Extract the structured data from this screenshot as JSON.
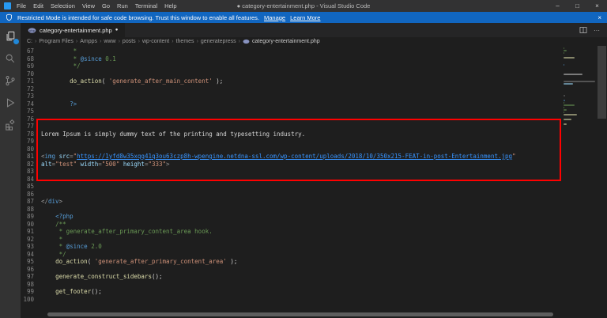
{
  "window": {
    "menus": [
      "File",
      "Edit",
      "Selection",
      "View",
      "Go",
      "Run",
      "Terminal",
      "Help"
    ],
    "title": "● category-entertainment.php - Visual Studio Code",
    "controls": {
      "minimize": "–",
      "maximize": "□",
      "close": "×"
    }
  },
  "banner": {
    "message": "Restricted Mode is intended for safe code browsing. Trust this window to enable all features.",
    "manage_link": "Manage",
    "learn_link": "Learn More",
    "close": "×"
  },
  "activity_bar": {
    "items": [
      "explorer",
      "search",
      "source-control",
      "run-debug",
      "extensions"
    ],
    "explorer_badge": true
  },
  "tabs": {
    "active": {
      "label": "category-entertainment.php",
      "modified": "●"
    },
    "actions": {
      "more": "···"
    }
  },
  "breadcrumb": {
    "separator": "›",
    "items": [
      "C:",
      "Program Files",
      "Ampps",
      "www",
      "posts",
      "wp-content",
      "themes",
      "generatepress",
      "category-entertainment.php"
    ]
  },
  "colors": {
    "banner_blue": "#1166c0",
    "badge_blue": "#2188d9",
    "annotation_red": "#ff0000",
    "php_icon_purple": "#8892bf"
  },
  "editor": {
    "lines": [
      {
        "n": "67",
        "t": [
          [
            "         *",
            "com"
          ]
        ]
      },
      {
        "n": "68",
        "t": [
          [
            "         * ",
            "com"
          ],
          [
            "@since",
            "key"
          ],
          [
            " 0.1",
            "com"
          ]
        ]
      },
      {
        "n": "69",
        "t": [
          [
            "         */",
            "com"
          ]
        ]
      },
      {
        "n": "70",
        "t": []
      },
      {
        "n": "71",
        "t": [
          [
            "        ",
            "pln"
          ],
          [
            "do_action",
            "fun"
          ],
          [
            "( ",
            "pln"
          ],
          [
            "'generate_after_main_content'",
            "str"
          ],
          [
            " );",
            "pln"
          ]
        ]
      },
      {
        "n": "72",
        "t": []
      },
      {
        "n": "73",
        "t": []
      },
      {
        "n": "74",
        "t": [
          [
            "        ",
            "pln"
          ],
          [
            "?>",
            "key"
          ]
        ]
      },
      {
        "n": "75",
        "t": []
      },
      {
        "n": "76",
        "t": []
      },
      {
        "n": "77",
        "t": []
      },
      {
        "n": "78",
        "t": [
          [
            "Lorem Ipsum is simply dummy text of the printing and typesetting industry.",
            "pln"
          ]
        ]
      },
      {
        "n": "79",
        "t": []
      },
      {
        "n": "80",
        "t": []
      },
      {
        "n": "81",
        "t": [
          [
            "<",
            "pun"
          ],
          [
            "img",
            "key"
          ],
          [
            " ",
            "pln"
          ],
          [
            "src",
            "att"
          ],
          [
            "=",
            "pun"
          ],
          [
            "\"",
            "str"
          ],
          [
            "https://1yfd8w35xqq41q3ou63czp8h-wpengine.netdna-ssl.com/wp-content/uploads/2018/10/350x215-FEAT-in-post-Entertainment.jpg",
            "url"
          ],
          [
            "\"",
            "str"
          ]
        ]
      },
      {
        "n": "82",
        "t": [
          [
            "alt",
            "att"
          ],
          [
            "=",
            "pun"
          ],
          [
            "\"test\"",
            "str"
          ],
          [
            " ",
            "pln"
          ],
          [
            "width",
            "att"
          ],
          [
            "=",
            "pun"
          ],
          [
            "\"500\"",
            "str"
          ],
          [
            " ",
            "pln"
          ],
          [
            "height",
            "att"
          ],
          [
            "=",
            "pun"
          ],
          [
            "\"333\"",
            "str"
          ],
          [
            ">",
            "pun"
          ]
        ]
      },
      {
        "n": "83",
        "t": []
      },
      {
        "n": "84",
        "t": []
      },
      {
        "n": "85",
        "t": []
      },
      {
        "n": "86",
        "t": []
      },
      {
        "n": "87",
        "t": [
          [
            "</",
            "pun"
          ],
          [
            "div",
            "key"
          ],
          [
            ">",
            "pun"
          ]
        ]
      },
      {
        "n": "88",
        "t": []
      },
      {
        "n": "89",
        "t": [
          [
            "    ",
            "pln"
          ],
          [
            "<?php",
            "key"
          ]
        ]
      },
      {
        "n": "90",
        "t": [
          [
            "    ",
            "pln"
          ],
          [
            "/**",
            "com"
          ]
        ]
      },
      {
        "n": "91",
        "t": [
          [
            "     * generate_after_primary_content_area hook.",
            "com"
          ]
        ]
      },
      {
        "n": "92",
        "t": [
          [
            "     *",
            "com"
          ]
        ]
      },
      {
        "n": "93",
        "t": [
          [
            "     * ",
            "com"
          ],
          [
            "@since",
            "key"
          ],
          [
            " 2.0",
            "com"
          ]
        ]
      },
      {
        "n": "94",
        "t": [
          [
            "     */",
            "com"
          ]
        ]
      },
      {
        "n": "95",
        "t": [
          [
            "    ",
            "pln"
          ],
          [
            "do_action",
            "fun"
          ],
          [
            "( ",
            "pln"
          ],
          [
            "'generate_after_primary_content_area'",
            "str"
          ],
          [
            " );",
            "pln"
          ]
        ]
      },
      {
        "n": "96",
        "t": []
      },
      {
        "n": "97",
        "t": [
          [
            "    ",
            "pln"
          ],
          [
            "generate_construct_sidebars",
            "fun"
          ],
          [
            "();",
            "pln"
          ]
        ]
      },
      {
        "n": "98",
        "t": []
      },
      {
        "n": "99",
        "t": [
          [
            "    ",
            "pln"
          ],
          [
            "get_footer",
            "fun"
          ],
          [
            "();",
            "pln"
          ]
        ]
      },
      {
        "n": "100",
        "t": []
      }
    ]
  }
}
